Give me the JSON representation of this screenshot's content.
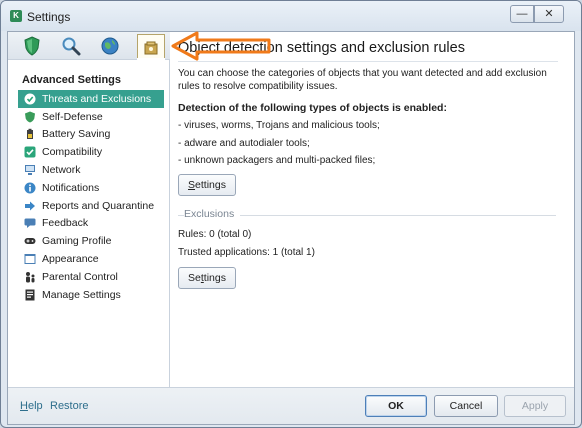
{
  "window": {
    "title": "Settings",
    "minimize_glyph": "—",
    "close_glyph": "✕"
  },
  "tabs": [
    {
      "name": "protection",
      "icon": "shield-icon"
    },
    {
      "name": "scan",
      "icon": "magnifier-icon"
    },
    {
      "name": "update",
      "icon": "globe-icon"
    },
    {
      "name": "settings",
      "icon": "settings-box-icon",
      "selected": true
    }
  ],
  "sidebar": {
    "heading": "Advanced Settings",
    "items": [
      {
        "label": "Threats and Exclusions",
        "icon": "threats-icon",
        "color": "#2aa57a",
        "active": true
      },
      {
        "label": "Self-Defense",
        "icon": "self-defense-icon",
        "color": "#3a9c5a"
      },
      {
        "label": "Battery Saving",
        "icon": "battery-icon",
        "color": "#404040"
      },
      {
        "label": "Compatibility",
        "icon": "compatibility-icon",
        "color": "#2aa57a"
      },
      {
        "label": "Network",
        "icon": "network-icon",
        "color": "#4a7fb5"
      },
      {
        "label": "Notifications",
        "icon": "notifications-icon",
        "color": "#3b86c6"
      },
      {
        "label": "Reports and Quarantine",
        "icon": "reports-icon",
        "color": "#3b86c6"
      },
      {
        "label": "Feedback",
        "icon": "feedback-icon",
        "color": "#4a7fb5"
      },
      {
        "label": "Gaming Profile",
        "icon": "gamepad-icon",
        "color": "#333333"
      },
      {
        "label": "Appearance",
        "icon": "appearance-icon",
        "color": "#4a7fb5"
      },
      {
        "label": "Parental Control",
        "icon": "parental-control-icon",
        "color": "#333333"
      },
      {
        "label": "Manage Settings",
        "icon": "manage-settings-icon",
        "color": "#333333"
      }
    ]
  },
  "main": {
    "heading": "Object detection settings and exclusion rules",
    "description": "You can choose the categories of objects that you want detected and add exclusion rules to resolve compatibility issues.",
    "detection_heading": "Detection of the following types of objects is enabled:",
    "detection_items": [
      "- viruses, worms, Trojans and malicious tools;",
      "- adware and autodialer tools;",
      "- unknown packagers and multi-packed files;"
    ],
    "settings_button_1": {
      "pre": "",
      "mnemonic": "S",
      "post": "ettings"
    },
    "exclusions_label": "Exclusions",
    "rules_text": "Rules: 0 (total 0)",
    "trusted_text": "Trusted applications: 1 (total 1)",
    "settings_button_2": {
      "pre": "Se",
      "mnemonic": "t",
      "post": "tings"
    }
  },
  "footer": {
    "help": {
      "pre": "",
      "mnemonic": "H",
      "post": "elp"
    },
    "restore": "Restore",
    "ok": "OK",
    "cancel": "Cancel",
    "apply": "Apply"
  },
  "annotation": {
    "arrow_color": "#f07a1a"
  }
}
